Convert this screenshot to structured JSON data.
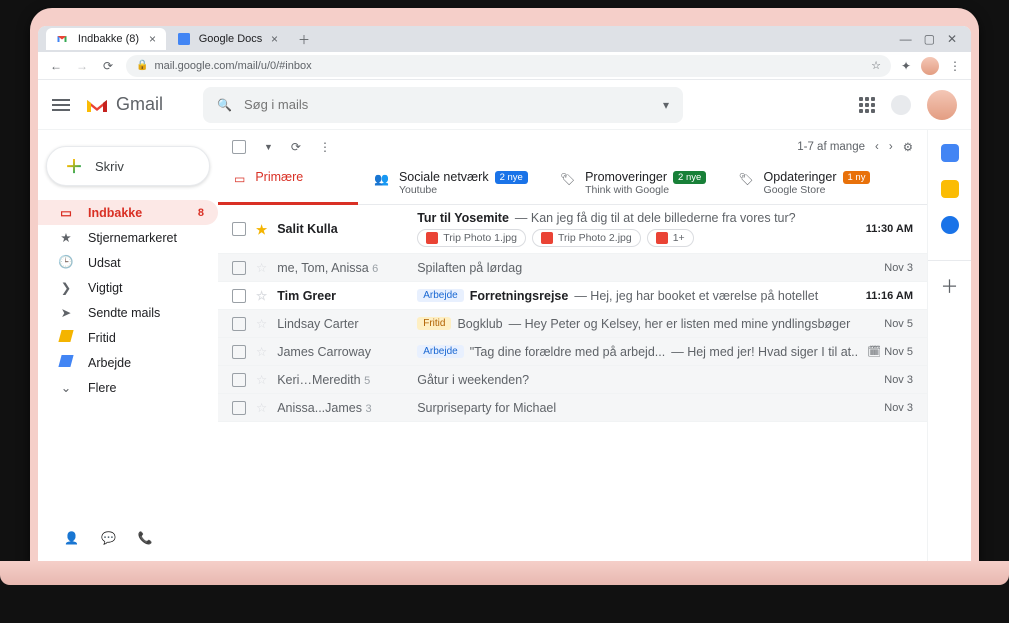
{
  "browser": {
    "tabs": [
      {
        "label": "Indbakke (8)",
        "active": true
      },
      {
        "label": "Google Docs",
        "active": false
      }
    ],
    "url": "mail.google.com/mail/u/0/#inbox"
  },
  "app": {
    "name": "Gmail"
  },
  "search": {
    "placeholder": "Søg i mails"
  },
  "compose": {
    "label": "Skriv"
  },
  "folders": [
    {
      "name": "Indbakke",
      "icon": "inbox",
      "count": "8",
      "active": true
    },
    {
      "name": "Stjernemarkeret",
      "icon": "star"
    },
    {
      "name": "Udsat",
      "icon": "clock"
    },
    {
      "name": "Vigtigt",
      "icon": "important"
    },
    {
      "name": "Sendte mails",
      "icon": "send"
    },
    {
      "name": "Fritid",
      "icon": "label-yellow"
    },
    {
      "name": "Arbejde",
      "icon": "label-blue"
    },
    {
      "name": "Flere",
      "icon": "chevron-down"
    }
  ],
  "pagination": {
    "text": "1-7 af mange"
  },
  "categories": [
    {
      "title": "Primære",
      "icon": "inbox",
      "active": true
    },
    {
      "title": "Sociale netværk",
      "icon": "people",
      "badge": "2 nye",
      "badgeColor": "blue",
      "sub": "Youtube"
    },
    {
      "title": "Promoveringer",
      "icon": "tag",
      "badge": "2 nye",
      "badgeColor": "green",
      "sub": "Think with Google"
    },
    {
      "title": "Opdateringer",
      "icon": "tag",
      "badge": "1 ny",
      "badgeColor": "orange",
      "sub": "Google Store"
    }
  ],
  "messages": [
    {
      "starred": true,
      "unread": true,
      "sender": "Salit Kulla",
      "subject": "Tur til Yosemite",
      "snippet": "— Kan jeg få dig til at dele billederne fra vores tur?",
      "date": "11:30 AM",
      "attachments": [
        "Trip Photo 1.jpg",
        "Trip Photo 2.jpg",
        "1+"
      ]
    },
    {
      "unread": false,
      "sender": "me, Tom, Anissa",
      "senderCount": "6",
      "subject": "Spilaften på lørdag",
      "date": "Nov 3"
    },
    {
      "unread": true,
      "sender": "Tim Greer",
      "chip": "Arbejde",
      "chipColor": "blue",
      "subject": "Forretningsrejse",
      "snippet": "— Hej, jeg har booket et værelse på hotellet",
      "date": "11:16 AM"
    },
    {
      "unread": false,
      "sender": "Lindsay Carter",
      "chip": "Fritid",
      "chipColor": "yellow",
      "subject": "Bogklub",
      "snippet": "— Hey Peter og Kelsey, her er listen med mine yndlingsbøger",
      "date": "Nov 5"
    },
    {
      "unread": false,
      "sender": "James Carroway",
      "chip": "Arbejde",
      "chipColor": "blue",
      "subject": "\"Tag dine forældre med på arbejd...",
      "snippet": "— Hej med jer! Hvad siger I til at...",
      "date": "Nov 5",
      "dateIcon": true
    },
    {
      "unread": false,
      "sender": "Keri…Meredith",
      "senderCount": "5",
      "subject": "Gåtur i weekenden?",
      "date": "Nov 3"
    },
    {
      "unread": false,
      "sender": "Anissa...James",
      "senderCount": "3",
      "subject": "Surpriseparty for Michael",
      "date": "Nov 3"
    }
  ]
}
